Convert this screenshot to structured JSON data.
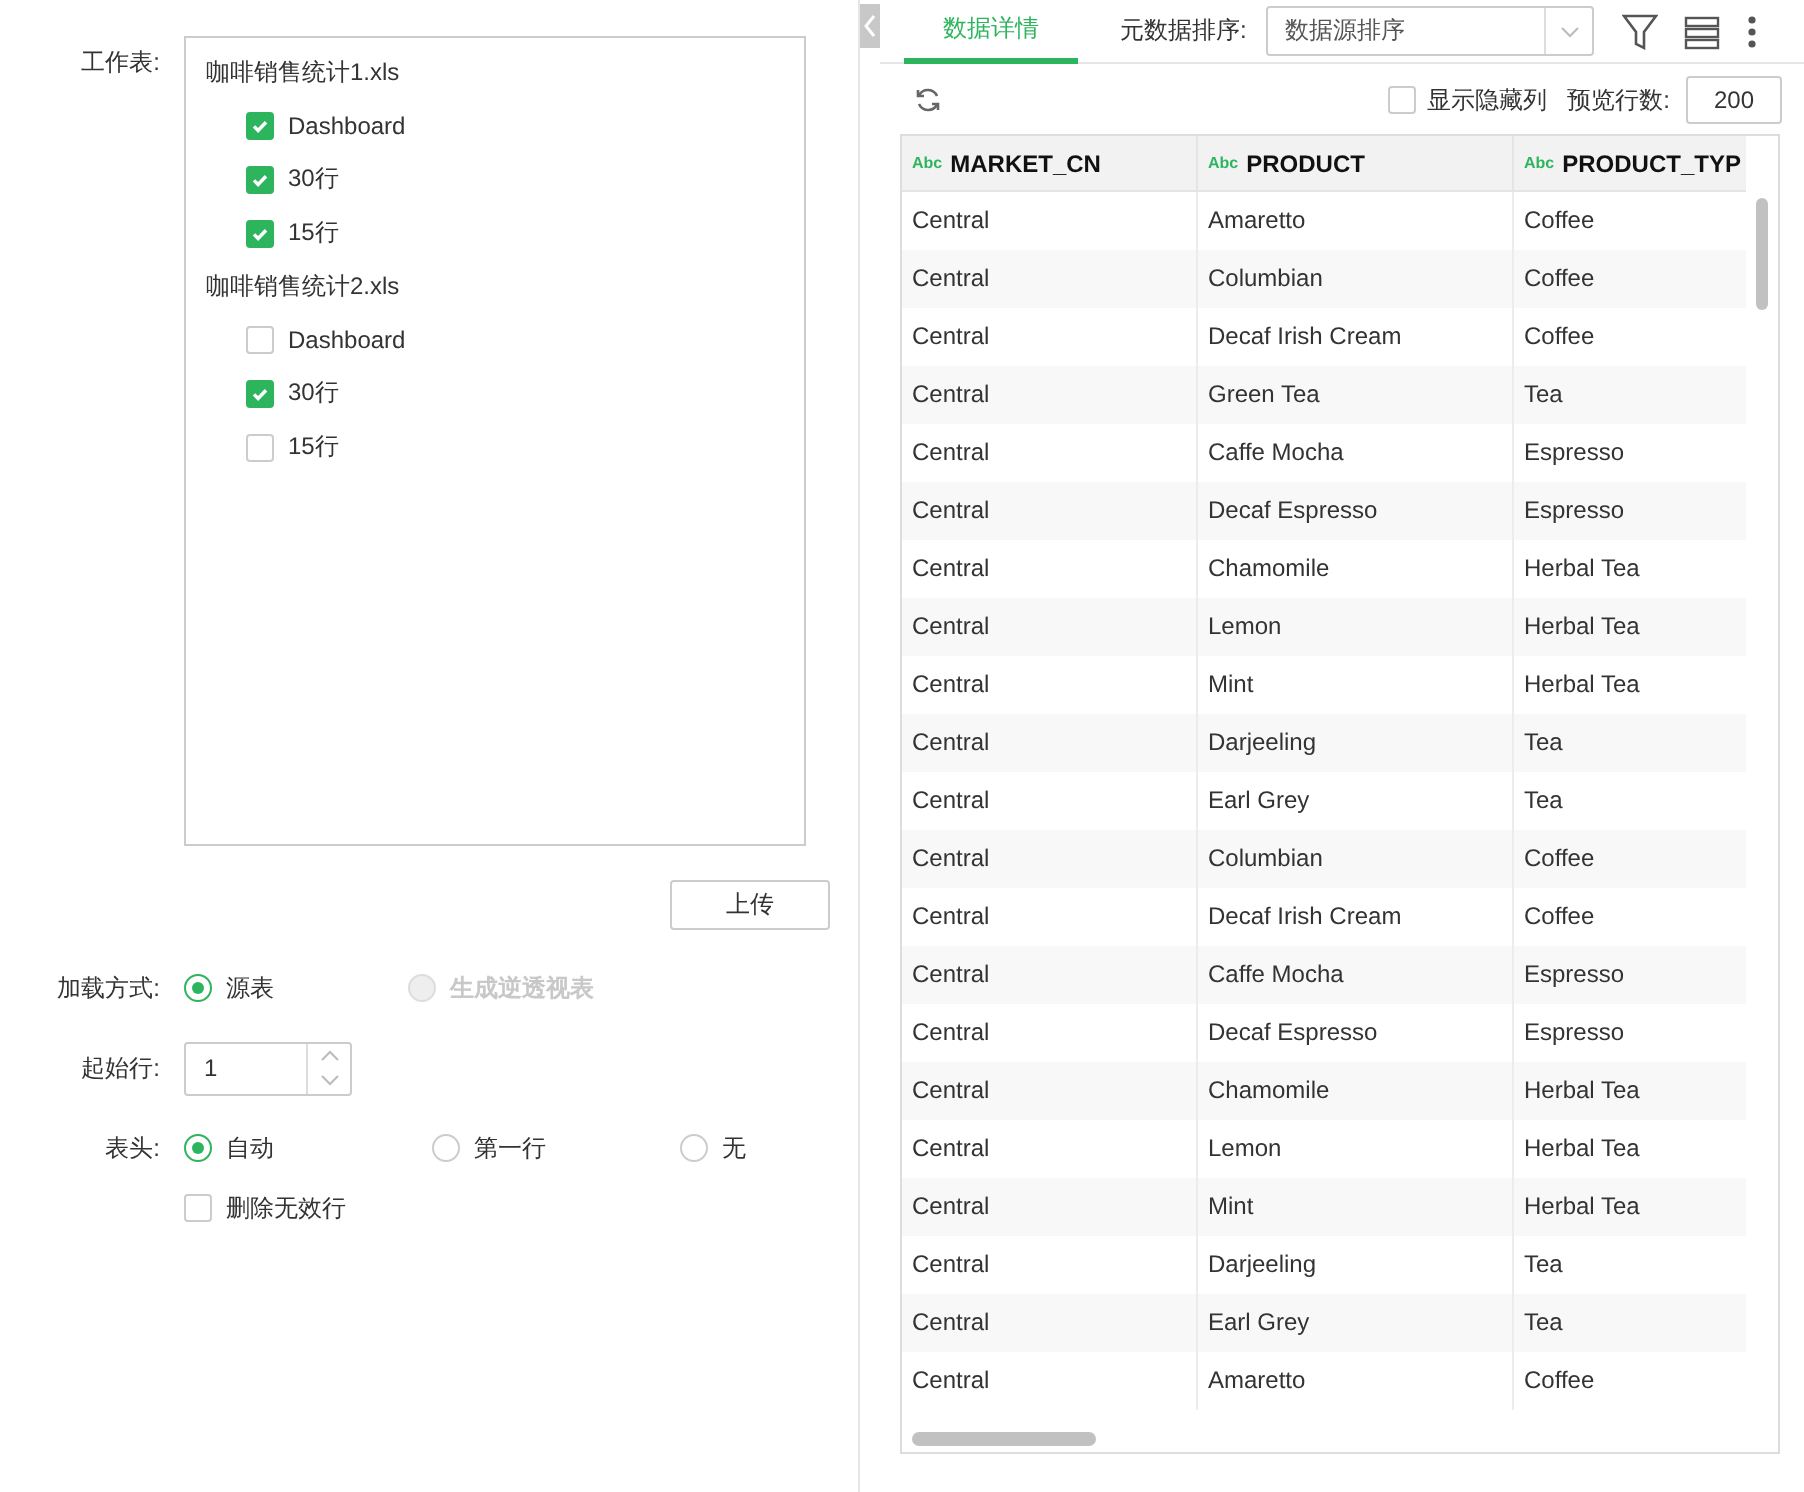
{
  "left": {
    "sheets_label": "工作表:",
    "files": [
      {
        "name": "咖啡销售统计1.xls",
        "sheets": [
          {
            "label": "Dashboard",
            "checked": true
          },
          {
            "label": "30行",
            "checked": true
          },
          {
            "label": "15行",
            "checked": true
          }
        ]
      },
      {
        "name": "咖啡销售统计2.xls",
        "sheets": [
          {
            "label": "Dashboard",
            "checked": false
          },
          {
            "label": "30行",
            "checked": true
          },
          {
            "label": "15行",
            "checked": false
          }
        ]
      }
    ],
    "upload_button": "上传",
    "load_label": "加载方式:",
    "load_options": [
      {
        "label": "源表",
        "selected": true,
        "disabled": false
      },
      {
        "label": "生成逆透视表",
        "selected": false,
        "disabled": true
      }
    ],
    "start_label": "起始行:",
    "start_value": "1",
    "header_label": "表头:",
    "header_options": [
      {
        "label": "自动",
        "selected": true
      },
      {
        "label": "第一行",
        "selected": false
      },
      {
        "label": "无",
        "selected": false
      }
    ],
    "remove_invalid": {
      "label": "删除无效行",
      "checked": false
    }
  },
  "right": {
    "tabs": [
      {
        "label": "数据详情",
        "selected": true
      }
    ],
    "sort_label": "元数据排序:",
    "sort_value": "数据源排序",
    "show_hidden": {
      "label": "显示隐藏列",
      "checked": false
    },
    "preview_label": "预览行数:",
    "preview_value": "200",
    "table": {
      "columns": [
        {
          "type": "Abc",
          "name": "MARKET_CN"
        },
        {
          "type": "Abc",
          "name": "PRODUCT"
        },
        {
          "type": "Abc",
          "name": "PRODUCT_TYP"
        }
      ],
      "rows": [
        [
          "Central",
          "Amaretto",
          "Coffee"
        ],
        [
          "Central",
          "Columbian",
          "Coffee"
        ],
        [
          "Central",
          "Decaf Irish Cream",
          "Coffee"
        ],
        [
          "Central",
          "Green Tea",
          "Tea"
        ],
        [
          "Central",
          "Caffe Mocha",
          "Espresso"
        ],
        [
          "Central",
          "Decaf Espresso",
          "Espresso"
        ],
        [
          "Central",
          "Chamomile",
          "Herbal Tea"
        ],
        [
          "Central",
          "Lemon",
          "Herbal Tea"
        ],
        [
          "Central",
          "Mint",
          "Herbal Tea"
        ],
        [
          "Central",
          "Darjeeling",
          "Tea"
        ],
        [
          "Central",
          "Earl Grey",
          "Tea"
        ],
        [
          "Central",
          "Columbian",
          "Coffee"
        ],
        [
          "Central",
          "Decaf Irish Cream",
          "Coffee"
        ],
        [
          "Central",
          "Caffe Mocha",
          "Espresso"
        ],
        [
          "Central",
          "Decaf Espresso",
          "Espresso"
        ],
        [
          "Central",
          "Chamomile",
          "Herbal Tea"
        ],
        [
          "Central",
          "Lemon",
          "Herbal Tea"
        ],
        [
          "Central",
          "Mint",
          "Herbal Tea"
        ],
        [
          "Central",
          "Darjeeling",
          "Tea"
        ],
        [
          "Central",
          "Earl Grey",
          "Tea"
        ],
        [
          "Central",
          "Amaretto",
          "Coffee"
        ]
      ]
    }
  }
}
